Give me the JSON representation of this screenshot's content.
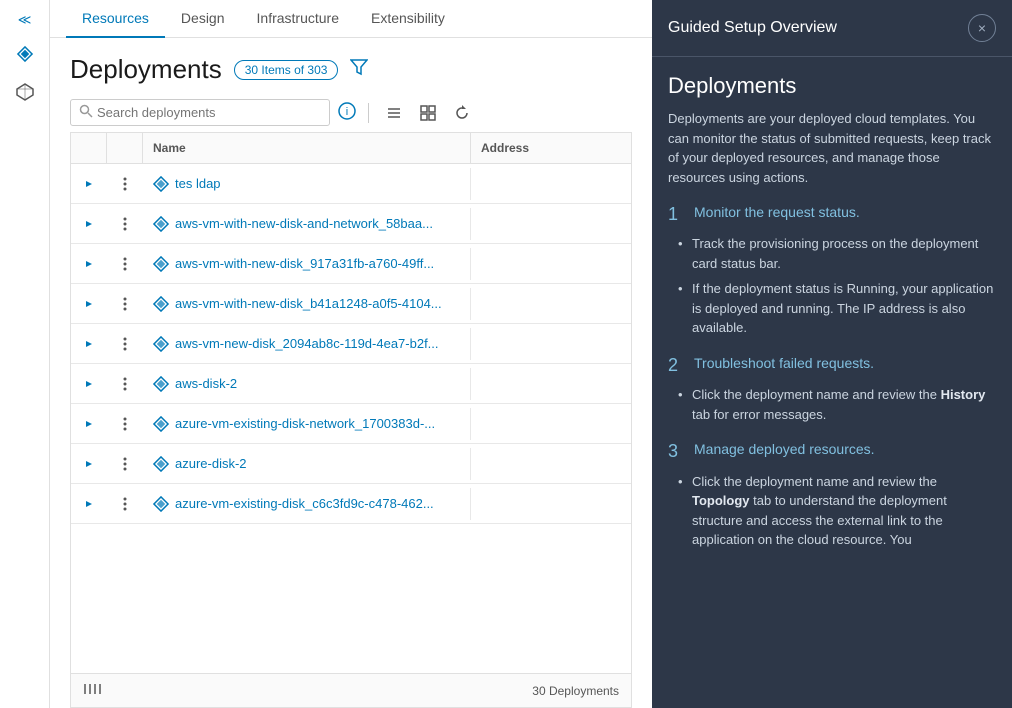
{
  "nav": {
    "tabs": [
      {
        "label": "Resources",
        "active": true
      },
      {
        "label": "Design",
        "active": false
      },
      {
        "label": "Infrastructure",
        "active": false
      },
      {
        "label": "Extensibility",
        "active": false
      }
    ]
  },
  "sidebar": {
    "toggle_label": "<<",
    "icons": [
      "diamond-icon",
      "cube-icon"
    ]
  },
  "header": {
    "title": "Deployments",
    "badge": "30 Items of 303",
    "filter_label": "filter"
  },
  "toolbar": {
    "search_placeholder": "Search deployments",
    "info_label": "ℹ",
    "list_view_label": "list",
    "grid_view_label": "grid",
    "refresh_label": "refresh"
  },
  "table": {
    "columns": [
      "",
      "",
      "Name",
      "Address"
    ],
    "rows": [
      {
        "name": "tes ldap",
        "address": ""
      },
      {
        "name": "aws-vm-with-new-disk-and-network_58baa...",
        "address": ""
      },
      {
        "name": "aws-vm-with-new-disk_917a31fb-a760-49ff...",
        "address": ""
      },
      {
        "name": "aws-vm-with-new-disk_b41a1248-a0f5-4104...",
        "address": ""
      },
      {
        "name": "aws-vm-new-disk_2094ab8c-119d-4ea7-b2f...",
        "address": ""
      },
      {
        "name": "aws-disk-2",
        "address": ""
      },
      {
        "name": "azure-vm-existing-disk-network_1700383d-...",
        "address": ""
      },
      {
        "name": "azure-disk-2",
        "address": ""
      },
      {
        "name": "azure-vm-existing-disk_c6c3fd9c-c478-462...",
        "address": ""
      }
    ],
    "footer": {
      "columns_label": "|||",
      "count_label": "30 Deployments"
    }
  },
  "guided_panel": {
    "header": "Guided Setup Overview",
    "close_label": "×",
    "section_title": "Deployments",
    "description": "Deployments are your deployed cloud templates. You can monitor the status of submitted requests, keep track of your deployed resources, and manage those resources using actions.",
    "steps": [
      {
        "number": "1",
        "title": "Monitor the request status.",
        "bullets": [
          "Track the provisioning process on the deployment card status bar.",
          "If the deployment status is Running, your application is deployed and running. The IP address is also available."
        ]
      },
      {
        "number": "2",
        "title": "Troubleshoot failed requests.",
        "bullets": [
          "Click the deployment name and review the History tab for error messages."
        ],
        "highlights": [
          "History"
        ]
      },
      {
        "number": "3",
        "title": "Manage deployed resources.",
        "bullets": [
          "Click the deployment name and review the Topology tab to understand the deployment structure and access the external link to the application on the cloud resource. You"
        ],
        "highlights": [
          "Topology"
        ]
      }
    ]
  }
}
